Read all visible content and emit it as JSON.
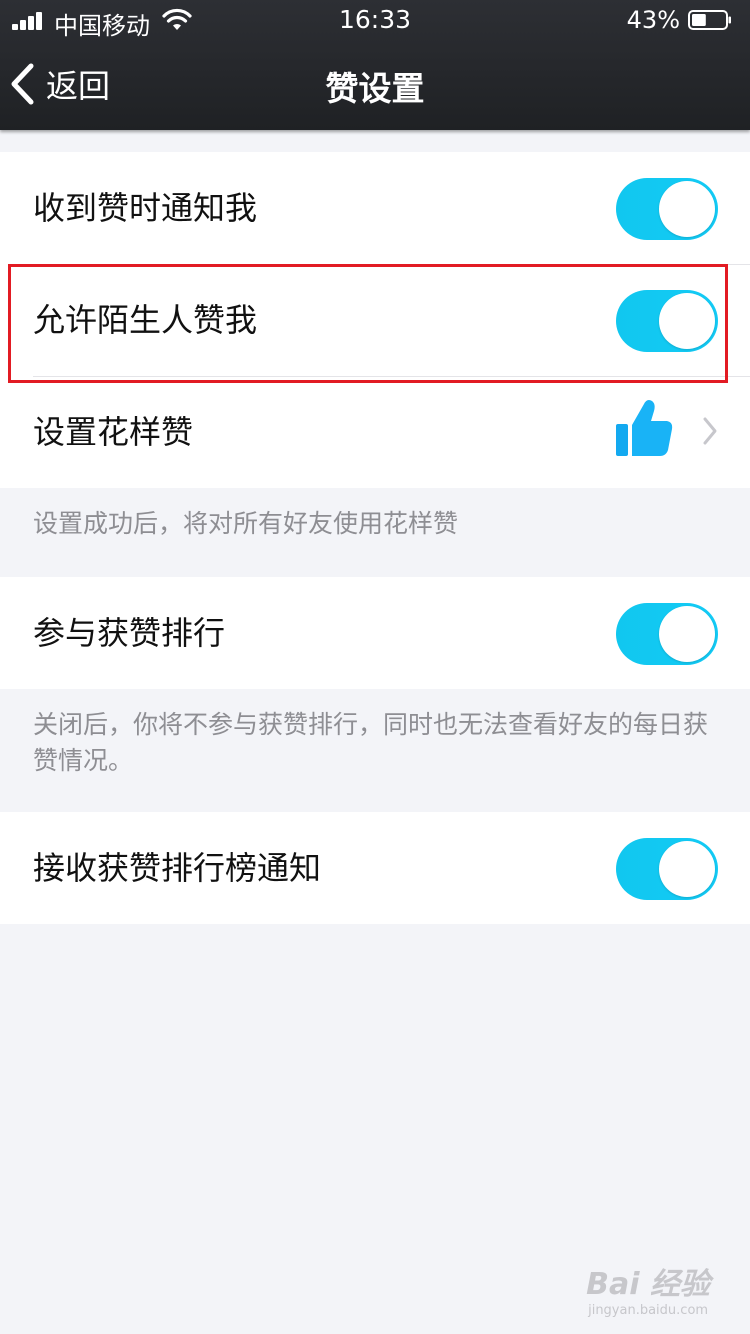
{
  "status_bar": {
    "carrier": "中国移动",
    "time": "16:33",
    "battery_percent": "43%",
    "battery_level": 0.43
  },
  "nav": {
    "back_label": "返回",
    "title": "赞设置"
  },
  "section1": {
    "items": [
      {
        "label": "收到赞时通知我",
        "toggle_on": true
      },
      {
        "label": "允许陌生人赞我",
        "toggle_on": true
      },
      {
        "label": "设置花样赞",
        "icon": "thumbs-up-icon"
      }
    ],
    "note": "设置成功后，将对所有好友使用花样赞"
  },
  "section2": {
    "items": [
      {
        "label": "参与获赞排行",
        "toggle_on": true
      }
    ],
    "note": "关闭后，你将不参与获赞排行，同时也无法查看好友的每日获赞情况。"
  },
  "section3": {
    "items": [
      {
        "label": "接收获赞排行榜通知",
        "toggle_on": true
      }
    ]
  },
  "watermark": {
    "main": "Bai 经验",
    "sub": "jingyan.baidu.com"
  },
  "colors": {
    "toggle_on": "#13cbf6",
    "highlight": "#e21b23",
    "nav_bg": "#26282c",
    "page_bg": "#f3f4f8"
  }
}
